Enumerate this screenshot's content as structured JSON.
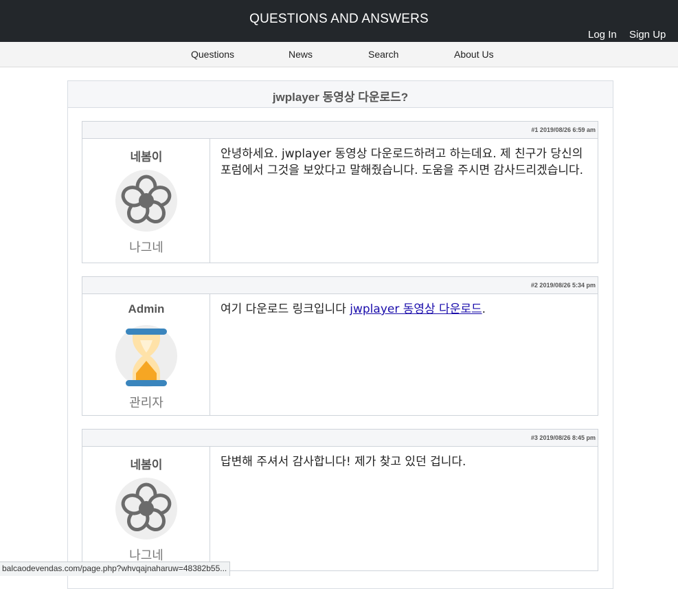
{
  "header": {
    "title": "QUESTIONS AND ANSWERS",
    "login_label": "Log In",
    "signup_label": "Sign Up"
  },
  "nav": {
    "items": [
      {
        "label": "Questions"
      },
      {
        "label": "News"
      },
      {
        "label": "Search"
      },
      {
        "label": "About Us"
      }
    ]
  },
  "thread": {
    "title": "jwplayer 동영상 다운로드?",
    "posts": [
      {
        "meta": "#1 2019/08/26 6:59 am",
        "author": "네봄이",
        "avatar_icon": "flower-icon",
        "role": "나그네",
        "message": "안녕하세요. jwplayer 동영상 다운로드하려고 하는데요. 제 친구가 당신의 포럼에서 그것을 보았다고 말해줬습니다. 도움을 주시면 감사드리겠습니다."
      },
      {
        "meta": "#2 2019/08/26 5:34 pm",
        "author": "Admin",
        "avatar_icon": "hourglass-icon",
        "role": "관리자",
        "message_prefix": "여기 다운로드 링크입니다 ",
        "link_text": "jwplayer 동영상 다운로드",
        "message_suffix": "."
      },
      {
        "meta": "#3 2019/08/26 8:45 pm",
        "author": "네봄이",
        "avatar_icon": "flower-icon",
        "role": "나그네",
        "message": "답변해 주셔서 감사합니다! 제가 찾고 있던 겁니다."
      }
    ]
  },
  "status_bar": {
    "url": "balcaodevendas.com/page.php?whvqajnaharuw=48382b55..."
  },
  "colors": {
    "header_bg": "#23272b",
    "nav_bg": "#f4f4f4",
    "link": "#1a0dab",
    "hourglass_blue": "#3a85bd",
    "hourglass_sand": "#f6a623"
  }
}
